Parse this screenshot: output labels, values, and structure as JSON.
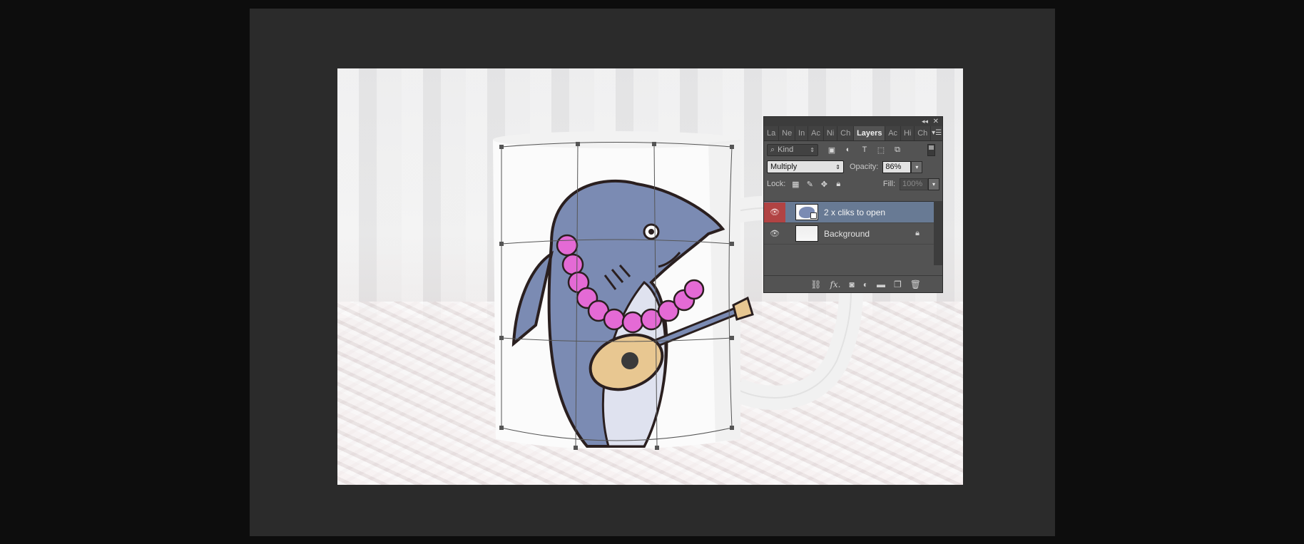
{
  "panel": {
    "tabs": [
      "La",
      "Ne",
      "In",
      "Ac",
      "Ni",
      "Ch",
      "Layers",
      "Ac",
      "Hi",
      "Ch"
    ],
    "active_tab": "Layers",
    "filter": {
      "label": "Kind"
    },
    "blend_mode": "Multiply",
    "opacity_label": "Opacity:",
    "opacity_value": "86%",
    "lock_label": "Lock:",
    "fill_label": "Fill:",
    "fill_value": "100%",
    "layers": [
      {
        "name": "2 x cliks to open",
        "selected": true,
        "locked": false
      },
      {
        "name": "Background",
        "selected": false,
        "locked": true
      }
    ]
  },
  "colors": {
    "canvas_bg": "#2b2b2b",
    "selected_layer": "#687a94",
    "eye_selected": "#b14343",
    "shark_body": "#7b8bb3",
    "lei_flower": "#e46ad5",
    "ukulele": "#e8c791"
  }
}
